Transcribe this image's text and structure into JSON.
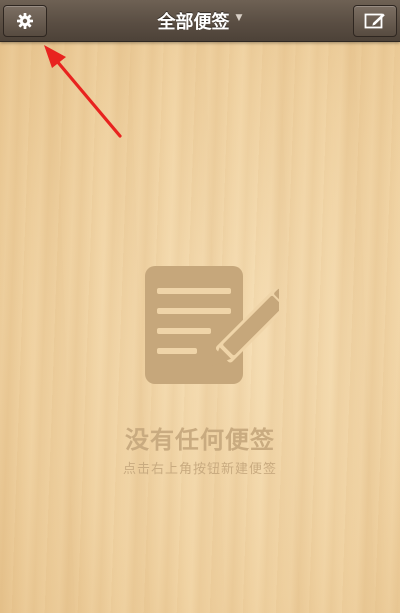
{
  "nav": {
    "title": "全部便签",
    "left_button_icon": "settings-icon",
    "right_button_icon": "compose-icon"
  },
  "empty_state": {
    "icon": "note-pencil-icon",
    "title": "没有任何便签",
    "subtitle": "点击右上角按钮新建便签"
  },
  "annotation": {
    "icon": "red-arrow-icon",
    "color": "#e8231f"
  },
  "colors": {
    "nav_bar": "#5a4e43",
    "background": "#f0d2a1",
    "empty_text": "#c9ab80",
    "empty_icon": "#c6a77b"
  }
}
